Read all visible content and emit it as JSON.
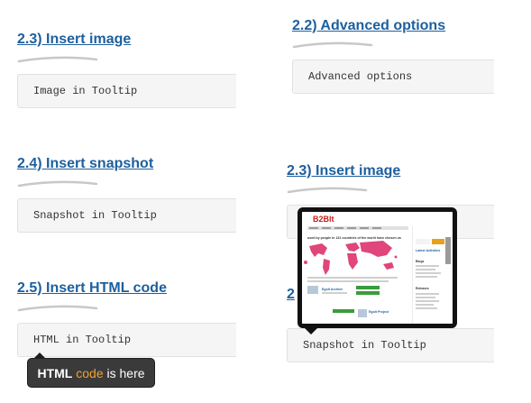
{
  "left": {
    "insert_image": {
      "title": "2.3) Insert image",
      "box_text": "Image in Tooltip"
    },
    "insert_snapshot": {
      "title": "2.4) Insert snapshot",
      "box_text": "Snapshot in Tooltip"
    },
    "insert_html": {
      "title": "2.5) Insert HTML code",
      "box_text": "HTML in Tooltip"
    }
  },
  "right": {
    "advanced": {
      "title": "2.2) Advanced options",
      "box_text": "Advanced options"
    },
    "insert_image": {
      "title": "2.3) Insert image"
    },
    "partial_heading": {
      "title": "2"
    },
    "snapshot_box": {
      "box_text": "Snapshot in Tooltip"
    }
  },
  "html_tooltip": {
    "part1": "HTML",
    "part2": "code",
    "part3": "is here"
  },
  "snapshot_preview": {
    "logo": "B2Blt",
    "headline": "used by people in 131 countries of the world have chosen us",
    "sidebar_title": "Latest Activities",
    "sidebar_item": "Blogs",
    "sidebar_item2": "Releases",
    "link1": "Egolt Archive",
    "link2": "Egolt Project"
  },
  "colors": {
    "heading": "#1d5f9e",
    "tooltip_bg": "#3a3a3a",
    "tooltip_accent": "#f0a030",
    "map": "#e0457b"
  }
}
